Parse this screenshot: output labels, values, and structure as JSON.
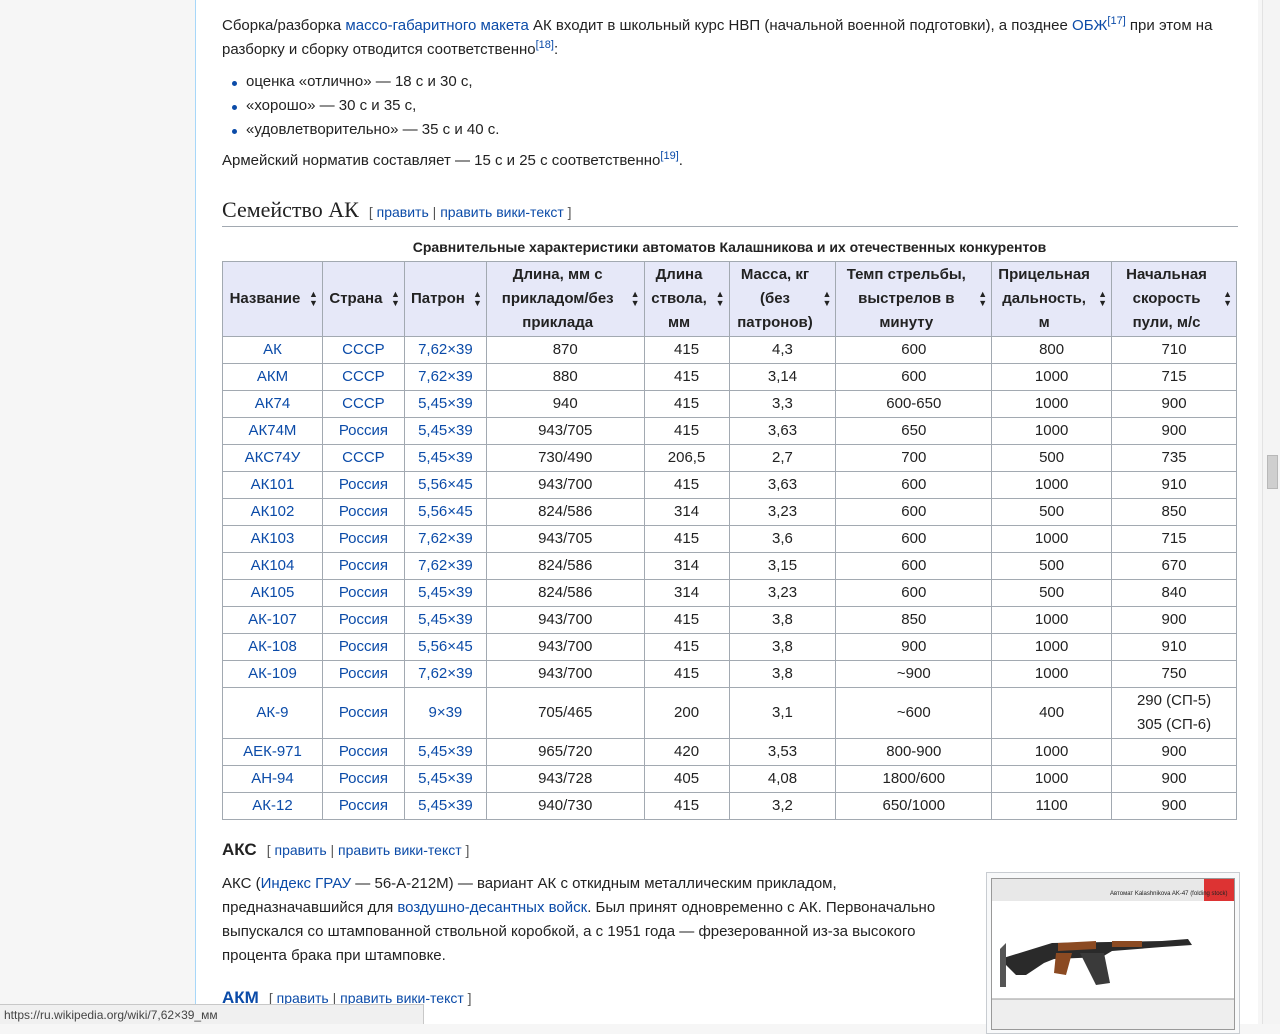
{
  "intro": {
    "p1_a": "Сборка/разборка ",
    "p1_link1": "массо-габаритного макета",
    "p1_b": " АК входит в школьный курс НВП (начальной военной подготовки), а позднее ",
    "p1_link2": "ОБЖ",
    "p1_ref1": "[17]",
    "p1_c": " при этом на разборку и сборку отводится соответственно",
    "p1_ref2": "[18]",
    "p1_d": ":",
    "bullets": [
      "оценка «отлично» — 18 с и 30 с,",
      "«хорошо» — 30 с и 35 с,",
      "«удовлетворительно» — 35 с и 40 с."
    ],
    "p2": "Армейский норматив составляет — 15 с и 25 с соответственно",
    "p2_ref": "[19]",
    "p2_end": "."
  },
  "section": {
    "title": "Семейство АК",
    "edit_open": "[ ",
    "edit_link": "править",
    "edit_sep": " | ",
    "edit_wiki": "править вики-текст",
    "edit_close": " ]"
  },
  "table": {
    "caption": "Сравнительные характеристики автоматов Калашникова и их отечественных конкурентов",
    "headers": [
      "Название",
      "Страна",
      "Патрон",
      "Длина, мм с прикладом/без приклада",
      "Длина ствола, мм",
      "Масса, кг (без патронов)",
      "Темп стрельбы, выстрелов в минуту",
      "Прицельная дальность, м",
      "Начальная скорость пули, м/с"
    ],
    "sort_icon": "◆",
    "rows": [
      [
        "АК",
        "СССР",
        "7,62×39",
        "870",
        "415",
        "4,3",
        "600",
        "800",
        "710"
      ],
      [
        "АКМ",
        "СССР",
        "7,62×39",
        "880",
        "415",
        "3,14",
        "600",
        "1000",
        "715"
      ],
      [
        "АК74",
        "СССР",
        "5,45×39",
        "940",
        "415",
        "3,3",
        "600-650",
        "1000",
        "900"
      ],
      [
        "АК74М",
        "Россия",
        "5,45×39",
        "943/705",
        "415",
        "3,63",
        "650",
        "1000",
        "900"
      ],
      [
        "АКС74У",
        "СССР",
        "5,45×39",
        "730/490",
        "206,5",
        "2,7",
        "700",
        "500",
        "735"
      ],
      [
        "АК101",
        "Россия",
        "5,56×45",
        "943/700",
        "415",
        "3,63",
        "600",
        "1000",
        "910"
      ],
      [
        "АК102",
        "Россия",
        "5,56×45",
        "824/586",
        "314",
        "3,23",
        "600",
        "500",
        "850"
      ],
      [
        "АК103",
        "Россия",
        "7,62×39",
        "943/705",
        "415",
        "3,6",
        "600",
        "1000",
        "715"
      ],
      [
        "АК104",
        "Россия",
        "7,62×39",
        "824/586",
        "314",
        "3,15",
        "600",
        "500",
        "670"
      ],
      [
        "АК105",
        "Россия",
        "5,45×39",
        "824/586",
        "314",
        "3,23",
        "600",
        "500",
        "840"
      ],
      [
        "АК-107",
        "Россия",
        "5,45×39",
        "943/700",
        "415",
        "3,8",
        "850",
        "1000",
        "900"
      ],
      [
        "АК-108",
        "Россия",
        "5,56×45",
        "943/700",
        "415",
        "3,8",
        "900",
        "1000",
        "910"
      ],
      [
        "АК-109",
        "Россия",
        "7,62×39",
        "943/700",
        "415",
        "3,8",
        "~900",
        "1000",
        "750"
      ],
      [
        "АК-9",
        "Россия",
        "9×39",
        "705/465",
        "200",
        "3,1",
        "~600",
        "400",
        "290 (СП-5)\n305 (СП-6)"
      ],
      [
        "АЕК-971",
        "Россия",
        "5,45×39",
        "965/720",
        "420",
        "3,53",
        "800-900",
        "1000",
        "900"
      ],
      [
        "АН-94",
        "Россия",
        "5,45×39",
        "943/728",
        "405",
        "4,08",
        "1800/600",
        "1000",
        "900"
      ],
      [
        "АК-12",
        "Россия",
        "5,45×39",
        "940/730",
        "415",
        "3,2",
        "650/1000",
        "1100",
        "900"
      ]
    ]
  },
  "aks": {
    "title": "АКС",
    "p_a": "АКС (",
    "p_link1": "Индекс ГРАУ",
    "p_b": " — 56-А-212М) — вариант АК с откидным металлическим прикладом, предназначавшийся для ",
    "p_link2": "воздушно-десантных войск",
    "p_c": ". Был принят одновременно с АК. Первоначально выпускался со штампованной ствольной коробкой, а с 1951 года — фрезерованной из-за высокого процента брака при штамповке."
  },
  "akm": {
    "title": "АКМ"
  },
  "thumb": {
    "caption": "Автомат Kalashnikova AK-47 (folding stock)"
  },
  "status_url": "https://ru.wikipedia.org/wiki/7,62×39_мм",
  "colors": {
    "link": "#0b4ba8",
    "header_bg": "#e6e8f8",
    "border": "#a2a9b1"
  }
}
